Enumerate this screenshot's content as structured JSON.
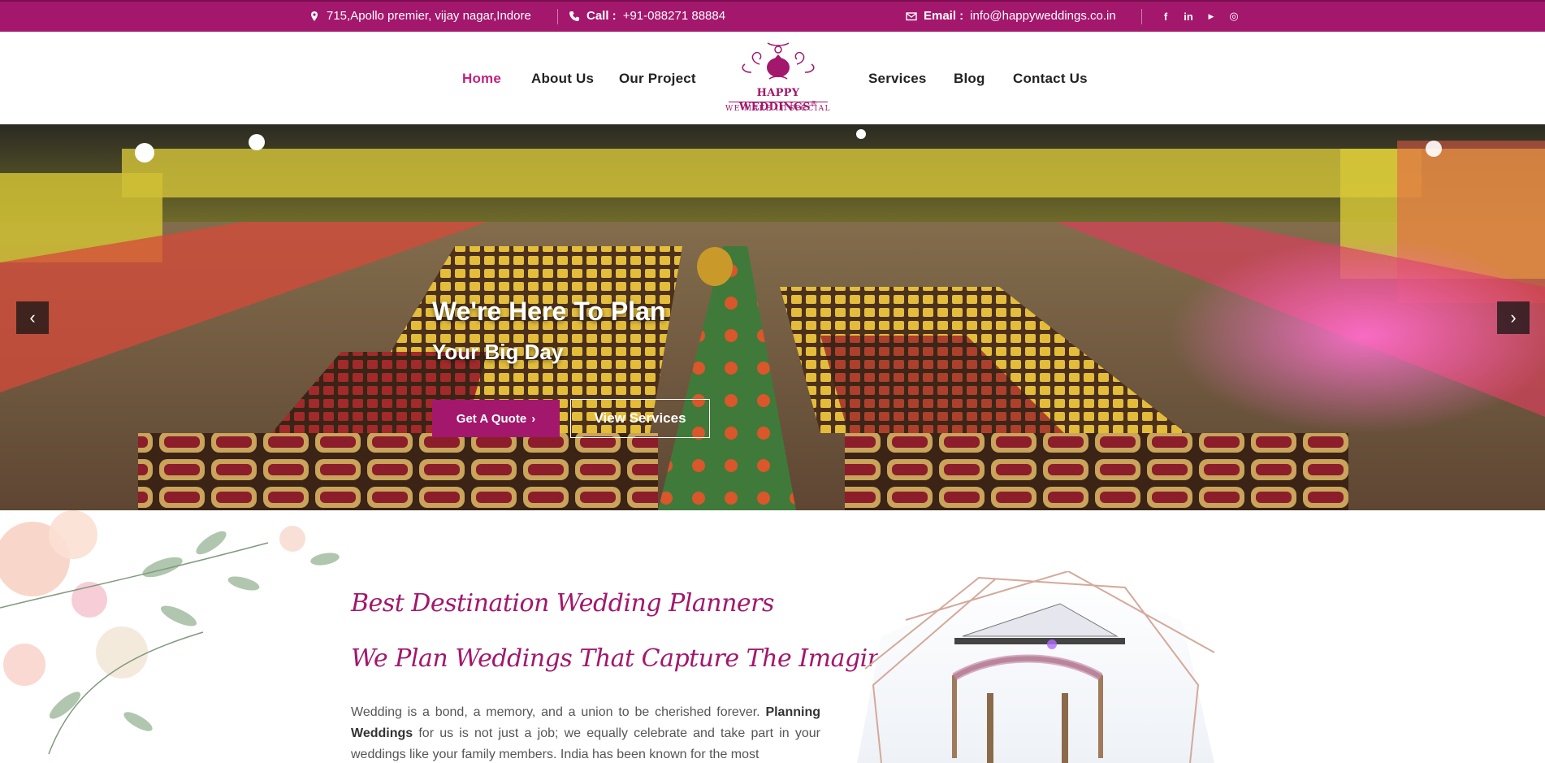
{
  "topbar": {
    "address": "715,Apollo premier, vijay nagar,Indore",
    "call_label": "Call :",
    "call_number": "+91-088271 88884",
    "email_label": "Email :",
    "email_value": "info@happyweddings.co.in",
    "social": [
      {
        "icon": "facebook-icon",
        "glyph": "f"
      },
      {
        "icon": "linkedin-icon",
        "glyph": "in"
      },
      {
        "icon": "youtube-icon",
        "glyph": "▶"
      },
      {
        "icon": "instagram-icon",
        "glyph": "◎"
      }
    ]
  },
  "nav": {
    "left": [
      "Home",
      "About Us",
      "Our Project"
    ],
    "right": [
      "Services",
      "Blog",
      "Contact Us"
    ],
    "active": "Home"
  },
  "logo": {
    "name": "HAPPY WEDDINGS",
    "registered": "®",
    "tagline": "WE MAKE IT SPECIAL"
  },
  "hero": {
    "title": "We're Here To Plan",
    "subtitle": "Your Big Day",
    "quote_button": "Get A Quote",
    "view_button": "View Services",
    "prev": "‹",
    "next": "›"
  },
  "about": {
    "heading1": "Best Destination Wedding Planners",
    "heading2": "We Plan Weddings That Capture The Imagination",
    "para_a": "Wedding is a bond, a memory, and a union to be cherished forever. ",
    "para_bold": "Planning Weddings",
    "para_b": " for us is not just a job; we equally celebrate and take part in your weddings like your family members. India has been known for the most"
  },
  "colors": {
    "brand": "#a3176c",
    "active_nav": "#c0237c"
  }
}
